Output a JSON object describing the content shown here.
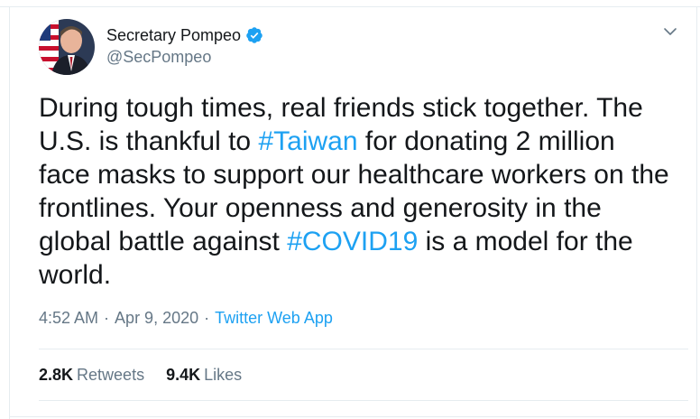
{
  "user": {
    "display_name": "Secretary Pompeo",
    "handle": "@SecPompeo",
    "verified_icon": "verified-badge-icon"
  },
  "tweet": {
    "text_parts": [
      "During tough times, real friends stick together. The\nU.S. is thankful to ",
      "#Taiwan",
      " for donating 2 million\nface masks to support our healthcare workers on the\nfrontlines. Your openness and generosity in the\nglobal battle against ",
      "#COVID19",
      " is a model for the\nworld."
    ]
  },
  "meta": {
    "time": "4:52 AM",
    "separator": "·",
    "date": "Apr 9, 2020",
    "source": "Twitter Web App"
  },
  "stats": {
    "retweets_count": "2.8K",
    "retweets_label": "Retweets",
    "likes_count": "9.4K",
    "likes_label": "Likes"
  },
  "colors": {
    "accent": "#1da1f2",
    "muted": "#657786",
    "text": "#14171a"
  }
}
